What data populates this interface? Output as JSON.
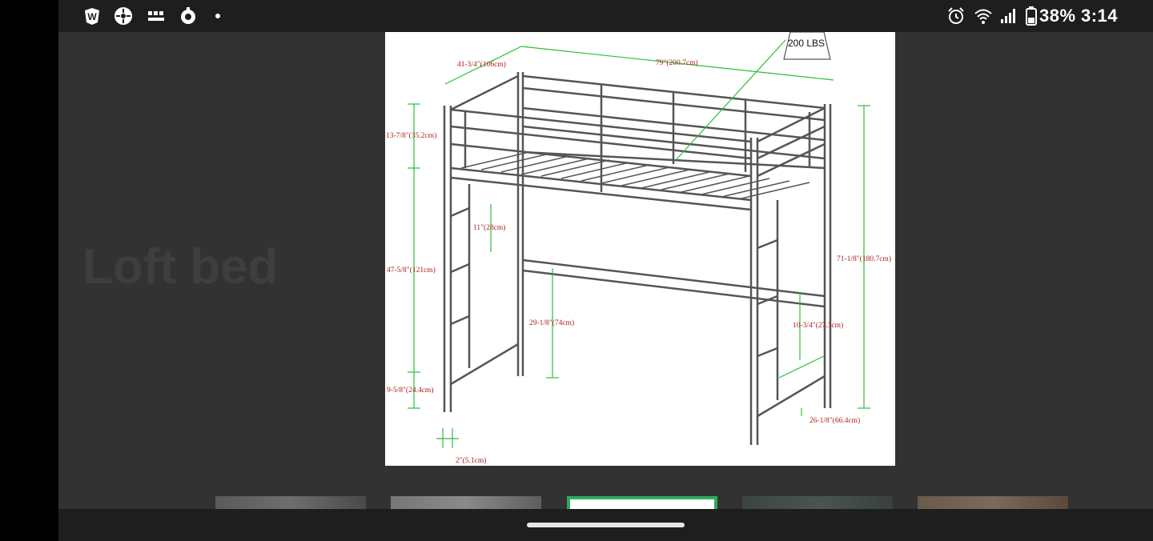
{
  "status_bar": {
    "left_icons": [
      "wordscapes-app-icon",
      "compass-app-icon",
      "bbc-news-icon",
      "location-pin-icon",
      "notification-dot-icon"
    ],
    "bbc_news_label": "BBC\nNEWS",
    "right_icons": [
      "alarm-icon",
      "wifi-icon",
      "signal-icon",
      "battery-icon"
    ],
    "battery": "38%",
    "time": "3:14"
  },
  "background": {
    "title": "Loft bed"
  },
  "diagram": {
    "weight_capacity": "200 LBS",
    "dimensions": {
      "depth": "41-3/4\"(106cm)",
      "length": "79\"(200.7cm)",
      "rail_height": "13-7/8\"(35.2cm)",
      "ladder_step": "11\"(28cm)",
      "under_height": "47-5/8\"(121cm)",
      "total_height": "71-1/8\"(180.7cm)",
      "bar_height": "29-1/8\"(74cm)",
      "ladder_gap": "10-3/4\"(27.3cm)",
      "bottom_rung": "9-5/8\"(24.4cm)",
      "ladder_width": "26-1/8\"(66.4cm)",
      "leg_width": "2\"(5.1cm)"
    },
    "colors": {
      "dimension_line": "#2bbf3a",
      "dimension_text": "#b02020",
      "frame": "#555555"
    }
  },
  "thumbnails": {
    "count": 5,
    "active_index": 2
  }
}
